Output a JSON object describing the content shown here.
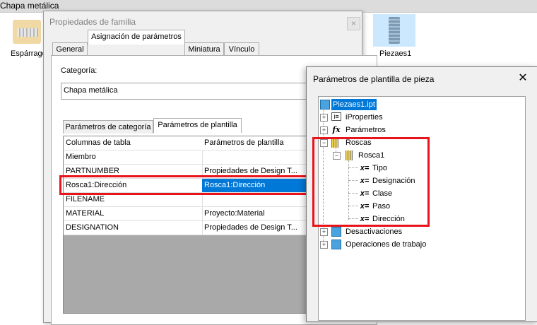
{
  "topbar": {
    "title": "Chapa metálica"
  },
  "background": {
    "thumb_left_label": "Espárrago",
    "thumb_right_label": "Piezaes1"
  },
  "family_dialog": {
    "title": "Propiedades de familia",
    "close_label": "×",
    "tabs": [
      "General",
      "Asignación de parámetros",
      "Miniatura",
      "Vínculo"
    ],
    "category_label": "Categoría:",
    "category_value": "Chapa metálica",
    "subtabs": [
      "Parámetros de categoría",
      "Parámetros de plantilla"
    ],
    "table": {
      "headers": [
        "Columnas de tabla",
        "Parámetros de plantilla"
      ],
      "rows": [
        [
          "Miembro",
          ""
        ],
        [
          "PARTNUMBER",
          "Propiedades de Design T..."
        ],
        [
          "Rosca1:Dirección",
          "Rosca1:Dirección"
        ],
        [
          "FILENAME",
          ""
        ],
        [
          "MATERIAL",
          "Proyecto:Material"
        ],
        [
          "DESIGNATION",
          "Propiedades de Design T..."
        ]
      ]
    }
  },
  "template_dialog": {
    "title": "Parámetros de plantilla de pieza",
    "close_label": "✕",
    "tree": {
      "root": "Piezaes1.ipt",
      "iproperties": "iProperties",
      "parametros": "Parámetros",
      "roscas": "Roscas",
      "rosca1": "Rosca1",
      "params": [
        "Tipo",
        "Designación",
        "Clase",
        "Paso",
        "Dirección"
      ],
      "desactivaciones": "Desactivaciones",
      "operaciones": "Operaciones de trabajo"
    }
  },
  "colors": {
    "highlight": "#e8141b",
    "selection": "#0078d7"
  }
}
